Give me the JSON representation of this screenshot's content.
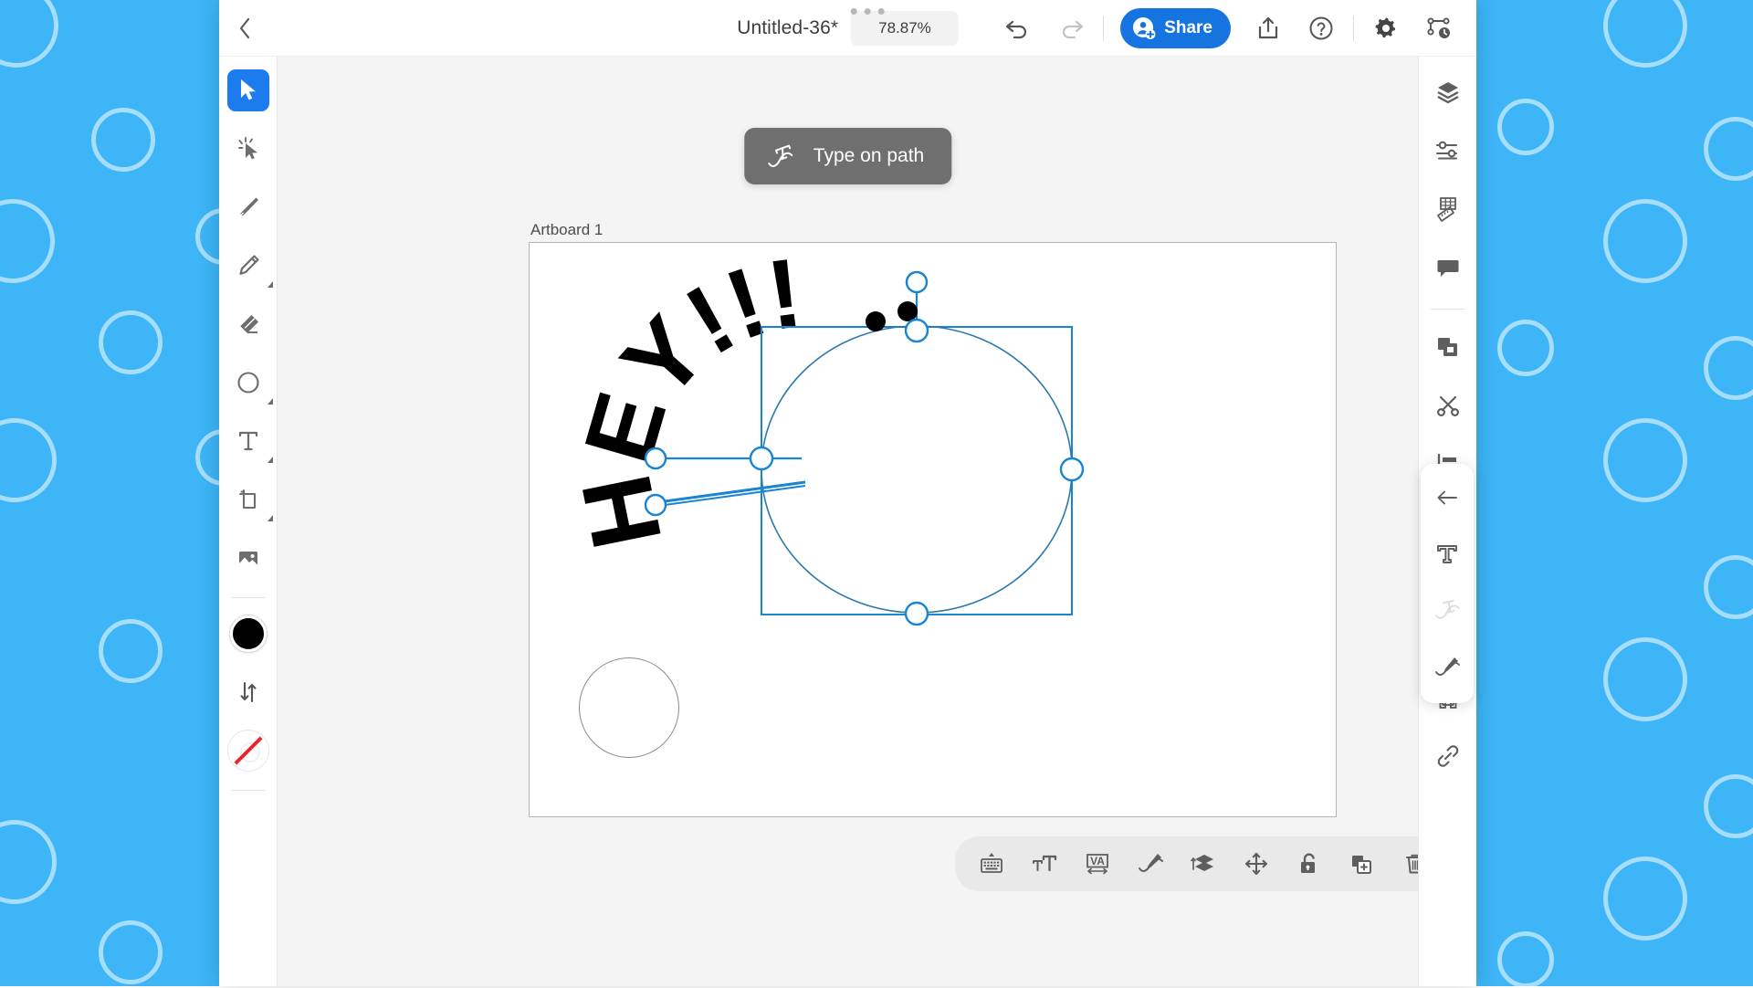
{
  "desktop": {
    "background_color": "#3db5f7",
    "bubble_color": "#b3e2fb"
  },
  "header": {
    "back_icon": "chevron-left-icon",
    "doc_title": "Untitled-36*",
    "zoom_level": "78.87%",
    "undo_icon": "undo-arrow-icon",
    "redo_icon": "redo-arrow-icon",
    "share_label": "Share",
    "share_icon": "add-person-icon",
    "share_color": "#1574e0",
    "export_icon": "export-upload-icon",
    "help_icon": "question-circle-icon",
    "settings_icon": "gear-icon",
    "history_icon": "version-history-icon"
  },
  "left_tools": [
    {
      "name": "select-tool",
      "icon": "cursor-arrow-icon",
      "active": true,
      "submenu": false
    },
    {
      "name": "node-select-tool",
      "icon": "magic-cursor-icon",
      "active": false,
      "submenu": false
    },
    {
      "name": "pen-tool",
      "icon": "pen-nib-icon",
      "active": false,
      "submenu": false
    },
    {
      "name": "pencil-tool",
      "icon": "pencil-icon",
      "active": false,
      "submenu": true
    },
    {
      "name": "eraser-tool",
      "icon": "eraser-icon",
      "active": false,
      "submenu": false
    },
    {
      "name": "shape-tool",
      "icon": "ellipse-icon",
      "active": false,
      "submenu": true
    },
    {
      "name": "text-tool",
      "icon": "text-t-icon",
      "active": false,
      "submenu": true
    },
    {
      "name": "crop-tool",
      "icon": "crop-artboard-icon",
      "active": false,
      "submenu": true
    },
    {
      "name": "image-tool",
      "icon": "image-picture-icon",
      "active": false,
      "submenu": false
    }
  ],
  "left_swatches": {
    "fill_color": "#000000",
    "swap_icon": "swap-arrows-icon",
    "stroke_color": "none"
  },
  "toast": {
    "icon": "type-on-path-icon",
    "label": "Type on path"
  },
  "canvas": {
    "artboard_label": "Artboard 1",
    "selection_color": "#1884d4",
    "artwork_text": "HEY!!!"
  },
  "context_toolbar": [
    {
      "name": "keyboard-button",
      "icon": "keyboard-icon"
    },
    {
      "name": "font-size-button",
      "icon": "font-size-icon"
    },
    {
      "name": "tracking-button",
      "icon": "letter-spacing-va-icon"
    },
    {
      "name": "type-on-path-button",
      "icon": "type-on-path-pen-icon"
    },
    {
      "name": "arrange-button",
      "icon": "layer-order-icon"
    },
    {
      "name": "move-button",
      "icon": "move-arrows-icon"
    },
    {
      "name": "lock-button",
      "icon": "unlock-padlock-icon"
    },
    {
      "name": "duplicate-button",
      "icon": "duplicate-plus-icon"
    },
    {
      "name": "delete-button",
      "icon": "trash-can-icon"
    }
  ],
  "right_rail": [
    {
      "name": "layers-panel",
      "icon": "layers-stack-icon",
      "selected": false
    },
    {
      "name": "adjustments-panel",
      "icon": "sliders-icon",
      "selected": false
    },
    {
      "name": "grid-ruler-panel",
      "icon": "grid-ruler-icon",
      "selected": false
    },
    {
      "name": "comments-panel",
      "icon": "speech-bubble-icon",
      "selected": false
    },
    {
      "name": "divider",
      "icon": "divider",
      "selected": false
    },
    {
      "name": "arrange-panel",
      "icon": "stacked-squares-icon",
      "selected": false
    },
    {
      "name": "cut-panel",
      "icon": "scissors-icon",
      "selected": false
    },
    {
      "name": "align-panel",
      "icon": "align-left-icon",
      "selected": false
    },
    {
      "name": "transform-panel",
      "icon": "transform-box-icon",
      "selected": false
    },
    {
      "name": "type-panel",
      "icon": "serif-t-icon",
      "selected": true
    },
    {
      "name": "path-panel",
      "icon": "bezier-path-icon",
      "selected": false
    },
    {
      "name": "effects-panel",
      "icon": "nodes-network-icon",
      "selected": false
    },
    {
      "name": "link-panel",
      "icon": "chain-link-icon",
      "selected": false
    }
  ],
  "flyout": [
    {
      "name": "back-button",
      "icon": "arrow-left-icon",
      "disabled": false
    },
    {
      "name": "text-style-button",
      "icon": "serif-t-icon",
      "disabled": false
    },
    {
      "name": "text-on-path-button",
      "icon": "text-on-path-icon",
      "disabled": true
    },
    {
      "name": "path-pen-button",
      "icon": "path-pen-icon",
      "disabled": false
    }
  ]
}
